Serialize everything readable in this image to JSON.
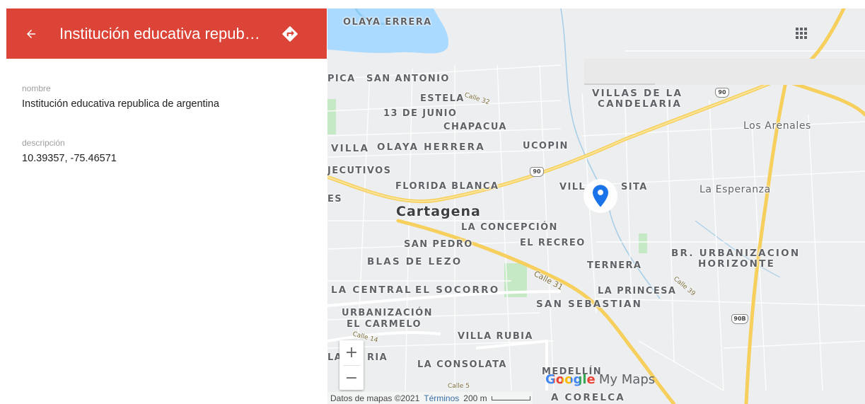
{
  "panel": {
    "back_icon": "arrow-left-icon",
    "title": "Institución educativa republica de argentina",
    "directions_icon": "directions-icon",
    "header_color": "#db4437",
    "fields": [
      {
        "label": "nombre",
        "value": "Institución educativa republica de argentina"
      },
      {
        "label": "descripción",
        "value": "10.39357, -75.46571"
      }
    ]
  },
  "map": {
    "grid_icon": "apps-grid-icon",
    "pin_icon": "map-pin-icon",
    "pin_color": "#1a73e8",
    "zoom_in": "+",
    "zoom_out": "−",
    "city": "Cartagena",
    "neighborhoods": [
      "OLAYA ERRERA",
      "PICA",
      "SAN ANTONIO",
      "ESTELA",
      "13 DE JUNIO",
      "CHAPACUA",
      "VILLA",
      "OLAYA HERRERA",
      "UCOPIN",
      "JECUTIVOS",
      "FLORIDA BLANCA",
      "VILL",
      "SITA",
      "ES",
      "LA CONCEPCIÓN",
      "SAN PEDRO",
      "EL RECREO",
      "BLAS DE LEZO",
      "TERNERA",
      "LA CENTRAL",
      "EL SOCORRO",
      "LA PRINCESA",
      "SAN SEBASTIAN",
      "URBANIZACIÓN",
      "EL CARMELO",
      "VILLA RUBIA",
      "LA",
      "RIA",
      "LA CONSOLATA",
      "MEDELLÍN",
      "A CORELCA"
    ],
    "areas": [
      {
        "line1": "VILLAS DE LA",
        "line2": "CANDELARIA"
      },
      {
        "line1": "BR. URBANIZACION",
        "line2": "HORIZONTE"
      }
    ],
    "places": [
      "Los Arenales",
      "La Esperanza"
    ],
    "streets": [
      "Calle 32",
      "Calle 31",
      "Calle 39",
      "Calle 14",
      "Calle 5"
    ],
    "shields": [
      "90",
      "90",
      "90B"
    ],
    "logo": {
      "google": "Google",
      "product": "My Maps"
    },
    "footer": {
      "data": "Datos de mapas ©2021",
      "terms": "Términos",
      "scale": "200 m"
    }
  }
}
